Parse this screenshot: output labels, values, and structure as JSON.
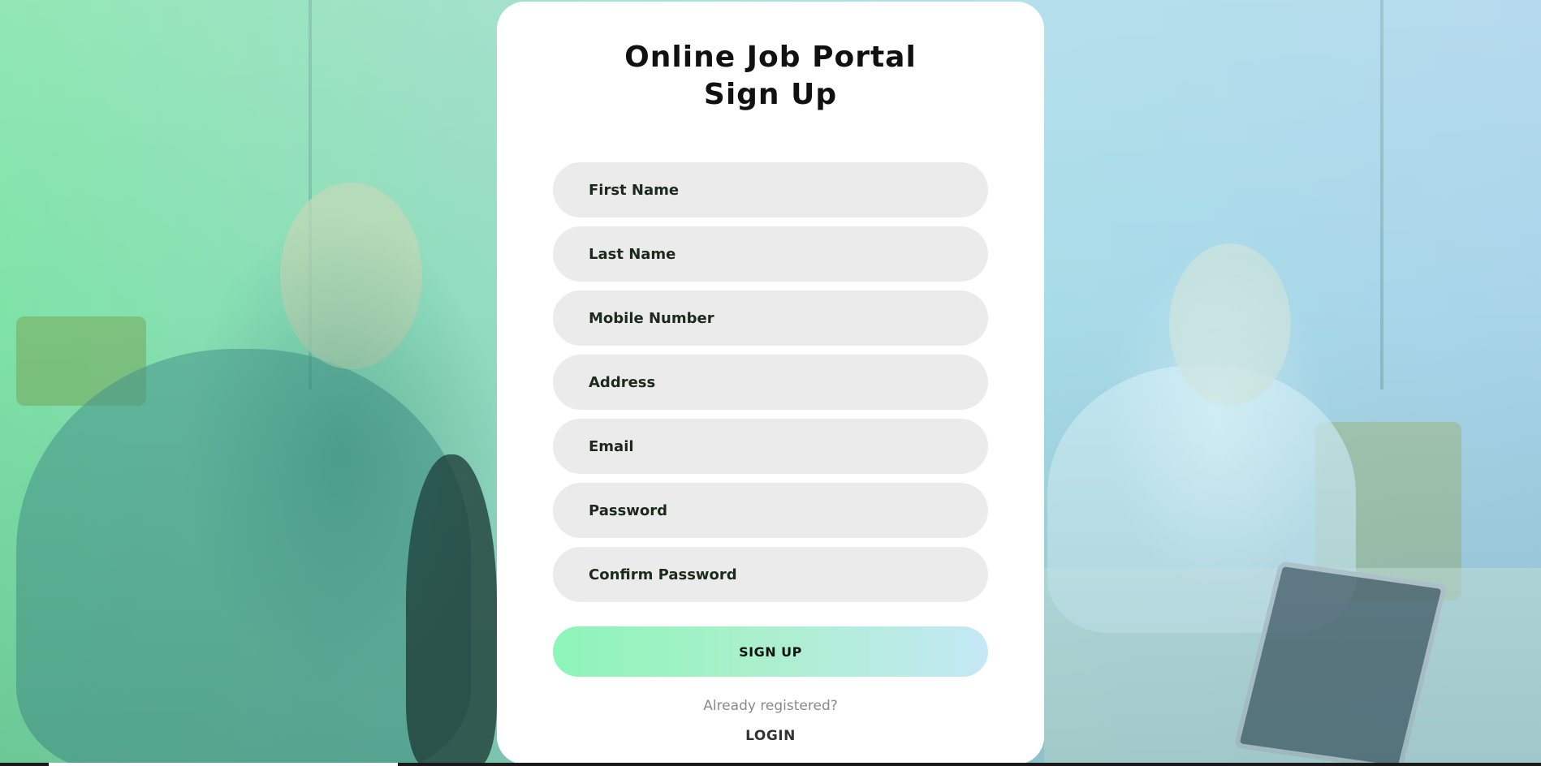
{
  "header": {
    "title_line1": "Online Job Portal",
    "title_line2": "Sign Up"
  },
  "form": {
    "fields": [
      {
        "name": "first-name-field",
        "placeholder": "First Name",
        "value": ""
      },
      {
        "name": "last-name-field",
        "placeholder": "Last Name",
        "value": ""
      },
      {
        "name": "mobile-number-field",
        "placeholder": "Mobile Number",
        "value": ""
      },
      {
        "name": "address-field",
        "placeholder": "Address",
        "value": ""
      },
      {
        "name": "email-field",
        "placeholder": "Email",
        "value": ""
      },
      {
        "name": "password-field",
        "placeholder": "Password",
        "value": ""
      },
      {
        "name": "confirm-password-field",
        "placeholder": "Confirm Password",
        "value": ""
      }
    ],
    "submit_label": "SIGN UP"
  },
  "footer": {
    "already_text": "Already registered?",
    "login_label": "LOGIN"
  },
  "colors": {
    "card_bg": "#ffffff",
    "field_bg": "#ebebeb",
    "button_gradient_start": "#8cf5b8",
    "button_gradient_end": "#c4e8f6",
    "background_tint_left": "#7fe3a8",
    "background_tint_right": "#a9d4ea"
  }
}
